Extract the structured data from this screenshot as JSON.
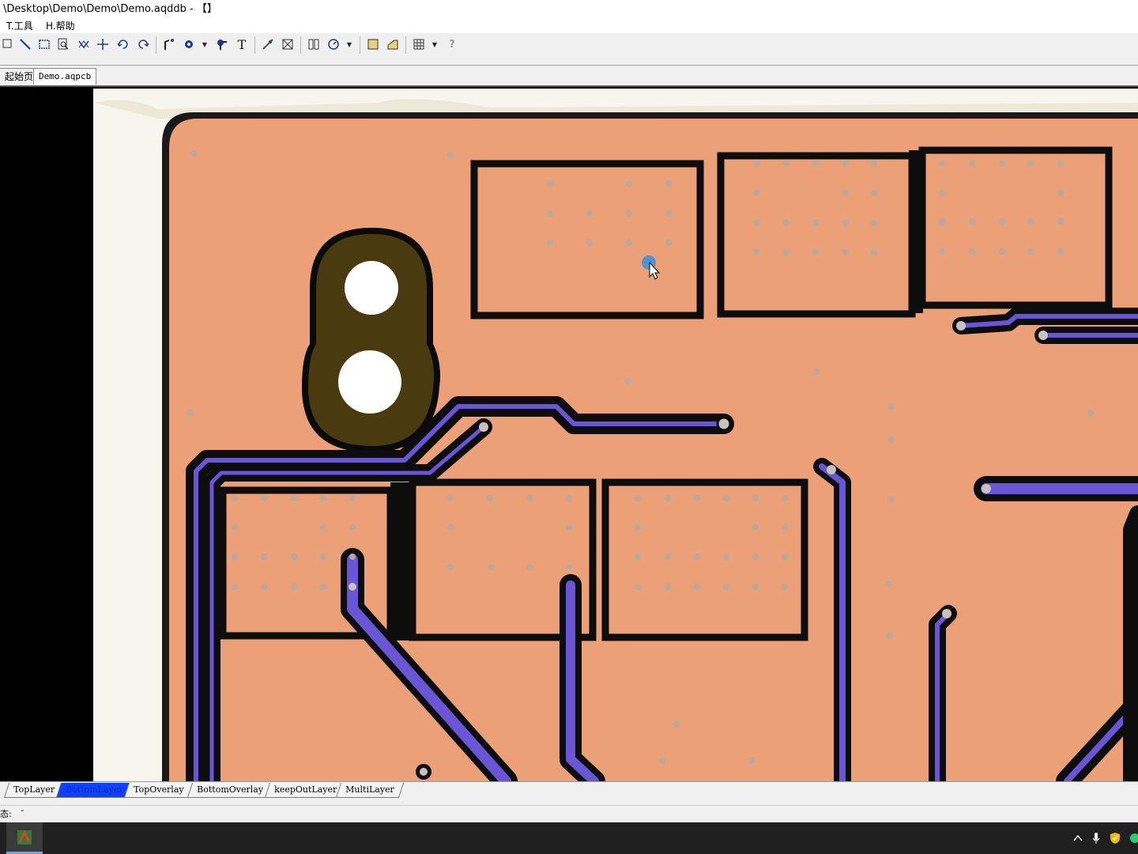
{
  "window": {
    "title": "\\Desktop\\Demo\\Demo\\Demo.aqddb - 【】"
  },
  "menu": {
    "items": [
      {
        "label": "T.工具"
      },
      {
        "label": "H.帮助"
      }
    ]
  },
  "toolbar": {
    "icons": [
      "select-icon",
      "line-tool-icon",
      "rect-select-icon",
      "zoom-icon",
      "swap-icon",
      "move-icon",
      "undo-icon",
      "redo-icon",
      "track-icon",
      "via-icon",
      "pad-icon",
      "text-icon",
      "measure-icon",
      "drc-icon",
      "layers-icon",
      "rotate-icon",
      "fill-icon",
      "polygon-icon",
      "grid-icon",
      "help-icon"
    ],
    "help_glyph": "?",
    "text_glyph": "T"
  },
  "tabs": [
    {
      "label": "起始页"
    },
    {
      "label": "Demo.aqpcb"
    }
  ],
  "layers": [
    {
      "label": "TopLayer"
    },
    {
      "label": "BottomLayer"
    },
    {
      "label": "TopOverlay"
    },
    {
      "label": "BottomOverlay"
    },
    {
      "label": "keepOutLayer"
    },
    {
      "label": "MultiLayer"
    }
  ],
  "active_layer": "BottomLayer",
  "status": {
    "label": "态:",
    "value": "-"
  },
  "colors": {
    "copper": "#e9a07c",
    "trace": "#6a55d6",
    "mask_gap": "#0c0c0c",
    "active_layer_tab": "#1040ff",
    "canvas_bg": "#000000",
    "board_edge": "#f5f3ec"
  }
}
